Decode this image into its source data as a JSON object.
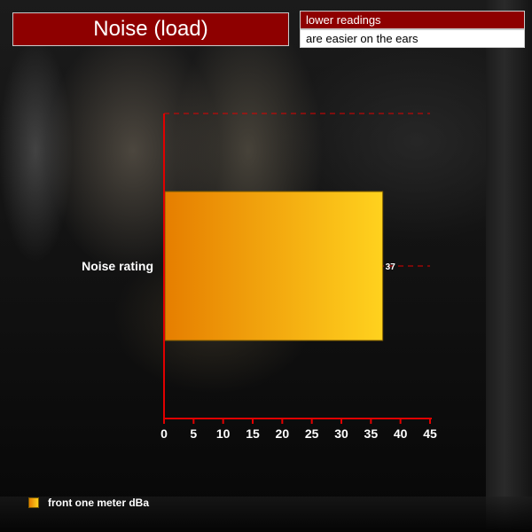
{
  "title": "Noise (load)",
  "notes": [
    "lower readings",
    "are easier on the ears"
  ],
  "colors": {
    "title_bg": "#8e0000",
    "axis": "#e00000",
    "bar_start": "#e67e00",
    "bar_end": "#ffd21e",
    "text": "#ffffff"
  },
  "chart_data": {
    "type": "bar",
    "orientation": "horizontal",
    "categories": [
      "Noise rating"
    ],
    "series": [
      {
        "name": "front one meter dBa",
        "values": [
          37
        ]
      }
    ],
    "data_labels": [
      "37"
    ],
    "xlim": [
      0,
      45
    ],
    "x_ticks": [
      "0",
      "5",
      "10",
      "15",
      "20",
      "25",
      "30",
      "35",
      "40",
      "45"
    ],
    "xlabel": "",
    "ylabel": "",
    "grid": true,
    "legend_position": "bottom-left"
  }
}
